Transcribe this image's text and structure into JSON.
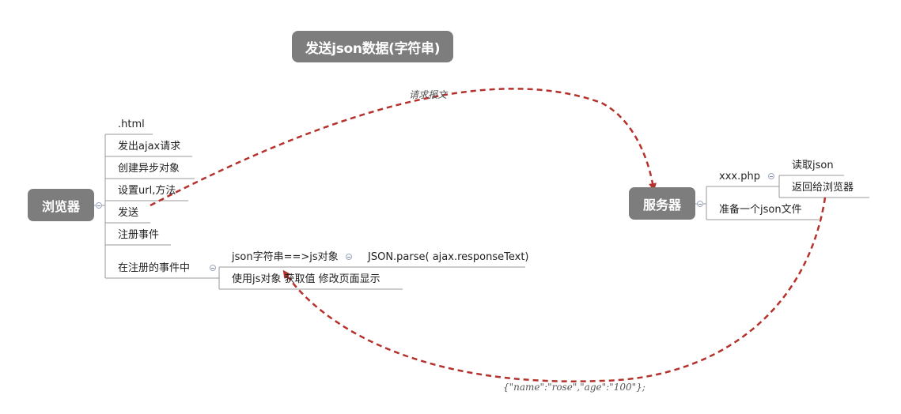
{
  "title": "发送json数据(字符串)",
  "browser": {
    "label": "浏览器",
    "items": [
      ".html",
      "发出ajax请求",
      "创建异步对象",
      "设置url,方法",
      "发送",
      "注册事件",
      "在注册的事件中"
    ],
    "event_children": {
      "item1": "json字符串==>js对象",
      "item1_child": "JSON.parse( ajax.responseText)",
      "item2": "使用js对象 获取值 修改页面显示"
    }
  },
  "server": {
    "label": "服务器",
    "items": [
      "xxx.php",
      "准备一个json文件"
    ],
    "php_children": [
      "读取json",
      "返回给浏览器"
    ]
  },
  "annotations": {
    "request": "请求报文",
    "response": "{\"name\":\"rose\",\"age\":\"100\"};"
  },
  "colors": {
    "node": "#7d7d7d",
    "arrow": "#b5312c",
    "line": "#9a9a9a"
  }
}
